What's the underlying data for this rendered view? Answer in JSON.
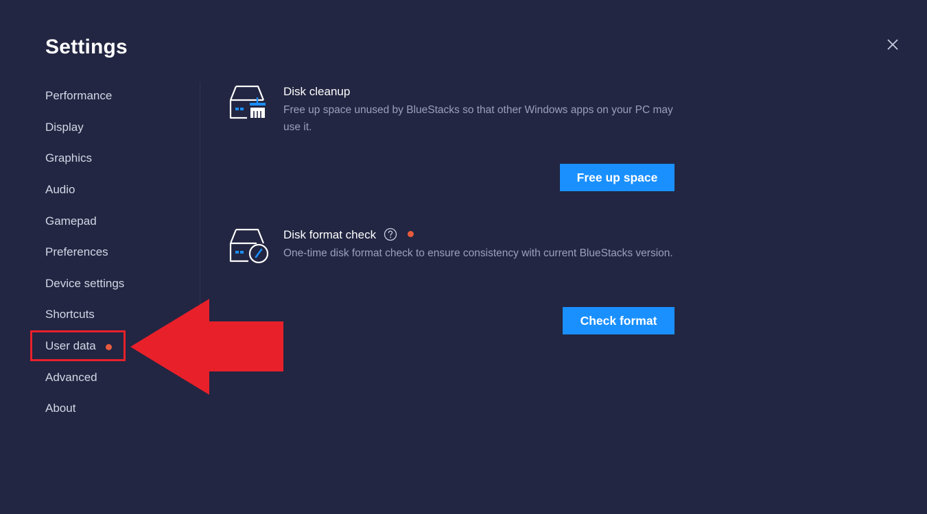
{
  "window": {
    "title": "Settings",
    "close_icon": "close-icon"
  },
  "sidebar": {
    "items": [
      {
        "label": "Performance"
      },
      {
        "label": "Display"
      },
      {
        "label": "Graphics"
      },
      {
        "label": "Audio"
      },
      {
        "label": "Gamepad"
      },
      {
        "label": "Preferences"
      },
      {
        "label": "Device settings"
      },
      {
        "label": "Shortcuts"
      },
      {
        "label": "User data",
        "has_notification_dot": true,
        "highlighted": true
      },
      {
        "label": "Advanced"
      },
      {
        "label": "About"
      }
    ]
  },
  "main": {
    "disk_cleanup": {
      "icon": "disk-cleanup-icon",
      "title": "Disk cleanup",
      "description": "Free up space unused by BlueStacks so that other Windows apps on your PC may use it.",
      "button_label": "Free up space"
    },
    "disk_format_check": {
      "icon": "disk-format-check-icon",
      "title": "Disk format check",
      "help_icon": "question-circle-icon",
      "has_notification_dot": true,
      "description": "One-time disk format check to ensure consistency with current BlueStacks version.",
      "button_label": "Check format"
    }
  },
  "annotation": {
    "arrow_icon": "red-arrow-left-icon",
    "highlight_target": "User data"
  },
  "colors": {
    "background": "#222642",
    "accent_blue": "#1a90ff",
    "notification_dot": "#e85a3d",
    "annotation_red": "#e8202a",
    "nav_text": "#d4d7e6",
    "secondary_text": "#9aa0bb"
  }
}
